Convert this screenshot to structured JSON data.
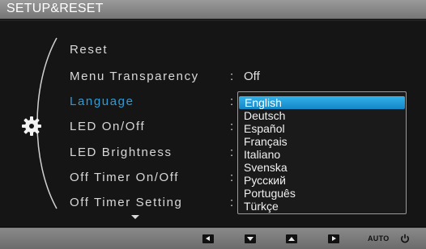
{
  "title": "SETUP&RESET",
  "icons": {
    "category": "gear-icon",
    "more": "chevron-down-icon"
  },
  "menu": [
    {
      "label": "Reset"
    },
    {
      "label": "Menu Transparency",
      "value": "Off"
    },
    {
      "label": "Language",
      "active": true
    },
    {
      "label": "LED On/Off"
    },
    {
      "label": "LED Brightness"
    },
    {
      "label": "Off Timer On/Off"
    },
    {
      "label": "Off Timer Setting"
    }
  ],
  "colon": ":",
  "language_options": [
    "English",
    "Deutsch",
    "Español",
    "Français",
    "Italiano",
    "Svenska",
    "Русский",
    "Português",
    "Türkçe"
  ],
  "selected_language": "English",
  "bottom_bar": {
    "buttons": [
      "left-arrow-icon",
      "down-arrow-icon",
      "up-arrow-icon",
      "enter-icon"
    ],
    "auto_label": "AUTO",
    "power": "power-icon"
  },
  "colors": {
    "accent": "#2e9bd6",
    "selection": "#1f9ddb",
    "text": "#d8d8d8"
  }
}
